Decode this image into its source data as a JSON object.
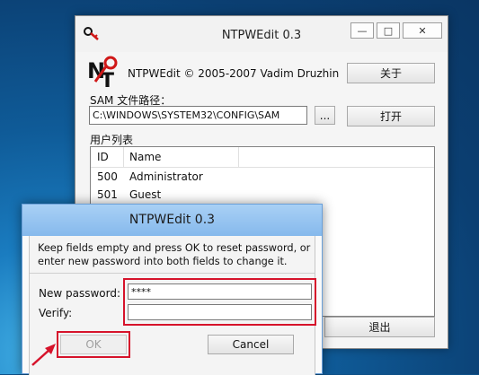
{
  "main_window": {
    "title": "NTPWEdit 0.3",
    "controls": {
      "minimize": "—",
      "maximize": "□",
      "close": "✕"
    },
    "about_text": "NTPWEdit © 2005-2007 Vadim Druzhin",
    "about_button": "关于",
    "sam_label": "SAM 文件路径：",
    "sam_path": "C:\\WINDOWS\\SYSTEM32\\CONFIG\\SAM",
    "browse_button": "...",
    "open_button": "打开",
    "users_label": "用户列表",
    "columns": {
      "id": "ID",
      "name": "Name"
    },
    "users": [
      {
        "id": "500",
        "name": "Administrator"
      },
      {
        "id": "501",
        "name": "Guest"
      }
    ],
    "exit_button": "退出"
  },
  "dialog": {
    "title": "NTPWEdit 0.3",
    "message": "Keep fields empty and press OK to reset password, or enter new password into both fields to change it.",
    "new_password_label": "New password:",
    "new_password_value": "****",
    "verify_label": "Verify:",
    "verify_value": "",
    "ok_button": "OK",
    "cancel_button": "Cancel"
  },
  "colors": {
    "highlight": "#d6132b",
    "dialog_title": "#86b9ec",
    "desktop": "#0f5b98"
  },
  "icons": {
    "app": "ntpwedit-key-icon",
    "arrow": "red-arrow-annotation"
  }
}
